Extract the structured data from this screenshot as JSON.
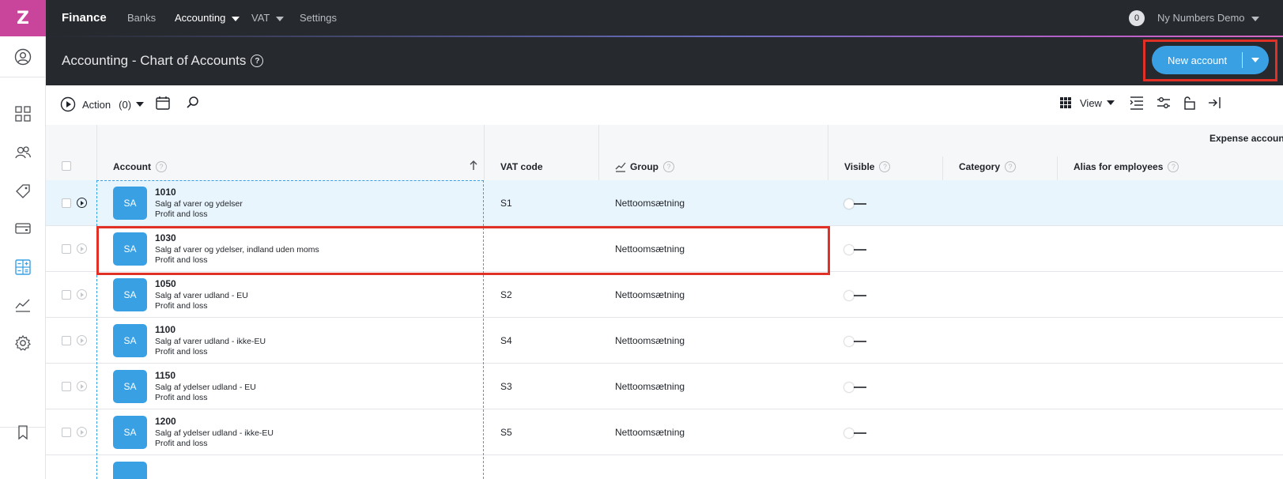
{
  "app": {
    "logo_letter": "Z",
    "name": "Finance",
    "nav": [
      "Banks",
      "Accounting",
      "VAT",
      "Settings"
    ],
    "notifications": "0",
    "company": "Ny Numbers Demo",
    "accent_color": "#3aa0e4",
    "brand_color": "#c9449b"
  },
  "header": {
    "title": "Accounting - Chart of Accounts",
    "help": "?",
    "new_button": "New account"
  },
  "toolbar": {
    "action_label": "Action",
    "action_count": "(0)",
    "view_label": "View"
  },
  "table": {
    "group_header": "Expense accoun",
    "columns": {
      "account": "Account",
      "vat_code": "VAT code",
      "group": "Group",
      "visible": "Visible",
      "category": "Category",
      "alias": "Alias for employees"
    },
    "help_glyph": "?",
    "rows": [
      {
        "avatar": "SA",
        "number": "1010",
        "name": "Salg af varer og ydelser",
        "type": "Profit and loss",
        "vat": "S1",
        "group": "Nettoomsætning"
      },
      {
        "avatar": "SA",
        "number": "1030",
        "name": "Salg af varer og ydelser, indland uden moms",
        "type": "Profit and loss",
        "vat": "",
        "group": "Nettoomsætning"
      },
      {
        "avatar": "SA",
        "number": "1050",
        "name": "Salg af varer udland - EU",
        "type": "Profit and loss",
        "vat": "S2",
        "group": "Nettoomsætning"
      },
      {
        "avatar": "SA",
        "number": "1100",
        "name": "Salg af varer udland - ikke-EU",
        "type": "Profit and loss",
        "vat": "S4",
        "group": "Nettoomsætning"
      },
      {
        "avatar": "SA",
        "number": "1150",
        "name": "Salg af ydelser udland - EU",
        "type": "Profit and loss",
        "vat": "S3",
        "group": "Nettoomsætning"
      },
      {
        "avatar": "SA",
        "number": "1200",
        "name": "Salg af ydelser udland - ikke-EU",
        "type": "Profit and loss",
        "vat": "S5",
        "group": "Nettoomsætning"
      }
    ]
  }
}
